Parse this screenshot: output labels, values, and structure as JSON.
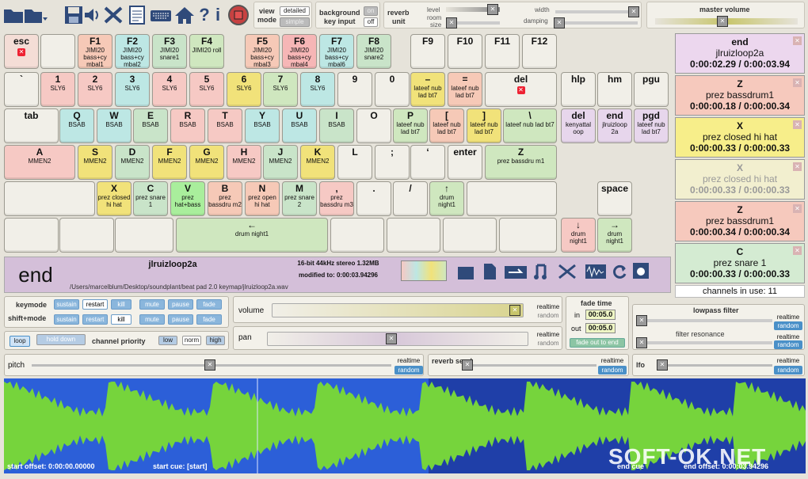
{
  "toolbar": {
    "icons": [
      "folder-icon",
      "folder-dropdown-icon",
      "save-icon",
      "speaker-save-icon",
      "tools-icon",
      "notes-icon",
      "keyboard-icon",
      "home-icon",
      "help-icon",
      "info-icon",
      "record-stop-icon"
    ],
    "view_label": "view",
    "mode_label": "mode",
    "view_detailed": "detailed",
    "view_simple": "simple",
    "background_label": "background",
    "key_input_label": "key input",
    "on_label": "on",
    "off_label": "off",
    "reverb_label": "reverb",
    "unit_label": "unit",
    "level_label": "level",
    "room_label": "room",
    "size_label": "size",
    "width_label": "width",
    "damping_label": "damping",
    "master_volume_label": "master volume"
  },
  "keys": [
    {
      "label": "esc",
      "sub": "",
      "color": "#f4ddd6",
      "close": true
    },
    {
      "label": "F1",
      "sub": "JIMI20 bass+cy mbal1",
      "color": "#f6c9b7"
    },
    {
      "label": "F2",
      "sub": "JIMI20 bass+cy mbal2",
      "color": "#bde7e4"
    },
    {
      "label": "F3",
      "sub": "JIMI20 snare1",
      "color": "#c9e4c9"
    },
    {
      "label": "F4",
      "sub": "JIMI20 roll",
      "color": "#cfe7bf"
    },
    {
      "label": "F5",
      "sub": "JIMI20 bass+cy mbal3",
      "color": "#f6c9b7"
    },
    {
      "label": "F6",
      "sub": "JIMI20 bass+cy mbal4",
      "color": "#f6b6b6"
    },
    {
      "label": "F7",
      "sub": "JIMI20 bass+cy mbal6",
      "color": "#bde7e4"
    },
    {
      "label": "F8",
      "sub": "JIMI20 snare2",
      "color": "#c9e4c9"
    },
    {
      "label": "F9",
      "sub": "",
      "color": "#f1efe8"
    },
    {
      "label": "F10",
      "sub": "",
      "color": "#f1efe8"
    },
    {
      "label": "F11",
      "sub": "",
      "color": "#f1efe8"
    },
    {
      "label": "F12",
      "sub": "",
      "color": "#f1efe8"
    },
    {
      "label": "`",
      "sub": "",
      "color": "#f1efe8"
    },
    {
      "label": "1",
      "sub": "SLY6",
      "color": "#f6c9c4"
    },
    {
      "label": "2",
      "sub": "SLY6",
      "color": "#f6c9c4"
    },
    {
      "label": "3",
      "sub": "SLY6",
      "color": "#bde7e4"
    },
    {
      "label": "4",
      "sub": "SLY6",
      "color": "#f6c9c4"
    },
    {
      "label": "5",
      "sub": "SLY6",
      "color": "#f6c9c4"
    },
    {
      "label": "6",
      "sub": "SLY6",
      "color": "#f1e27a"
    },
    {
      "label": "7",
      "sub": "SLY6",
      "color": "#cfe7bf"
    },
    {
      "label": "8",
      "sub": "SLY6",
      "color": "#bde7e4"
    },
    {
      "label": "9",
      "sub": "",
      "color": "#f1efe8"
    },
    {
      "label": "0",
      "sub": "",
      "color": "#f1efe8"
    },
    {
      "label": "–",
      "sub": "lateef nub lad bt7",
      "color": "#f1e27a"
    },
    {
      "label": "=",
      "sub": "lateef nub lad bt7",
      "color": "#f6c9b7"
    },
    {
      "label": "del",
      "sub": "",
      "color": "#f1efe8",
      "close": true
    },
    {
      "label": "hlp",
      "sub": "",
      "color": "#f1efe8"
    },
    {
      "label": "hm",
      "sub": "",
      "color": "#f1efe8"
    },
    {
      "label": "pgu",
      "sub": "",
      "color": "#f1efe8"
    },
    {
      "label": "tab",
      "sub": "",
      "color": "#f1efe8"
    },
    {
      "label": "Q",
      "sub": "BSAB",
      "color": "#bde7e4"
    },
    {
      "label": "W",
      "sub": "BSAB",
      "color": "#bde7e4"
    },
    {
      "label": "E",
      "sub": "BSAB",
      "color": "#c9e4c9"
    },
    {
      "label": "R",
      "sub": "BSAB",
      "color": "#f6c9c4"
    },
    {
      "label": "T",
      "sub": "BSAB",
      "color": "#f6c9c4"
    },
    {
      "label": "Y",
      "sub": "BSAB",
      "color": "#bde7e4"
    },
    {
      "label": "U",
      "sub": "BSAB",
      "color": "#bde7e4"
    },
    {
      "label": "I",
      "sub": "BSAB",
      "color": "#c9e4c9"
    },
    {
      "label": "O",
      "sub": "",
      "color": "#f1efe8"
    },
    {
      "label": "P",
      "sub": "lateef nub lad bt7",
      "color": "#cfe7bf"
    },
    {
      "label": "[",
      "sub": "lateef nub lad bt7",
      "color": "#f6c9b7"
    },
    {
      "label": "]",
      "sub": "lateef nub lad bt7",
      "color": "#f1e27a"
    },
    {
      "label": "\\",
      "sub": "lateef nub lad bt7",
      "color": "#cfe7bf"
    },
    {
      "label": "del",
      "sub": "kenyattal oop",
      "color": "#e7d6ec"
    },
    {
      "label": "end",
      "sub": "jlruizloop 2a",
      "color": "#e7d6ec"
    },
    {
      "label": "pgd",
      "sub": "lateef nub lad bt7",
      "color": "#e7d6ec"
    },
    {
      "label": "A",
      "sub": "MMEN2",
      "color": "#f6c9c4"
    },
    {
      "label": "S",
      "sub": "MMEN2",
      "color": "#f1e27a"
    },
    {
      "label": "D",
      "sub": "MMEN2",
      "color": "#c9e4c9"
    },
    {
      "label": "F",
      "sub": "MMEN2",
      "color": "#f1e27a"
    },
    {
      "label": "G",
      "sub": "MMEN2",
      "color": "#f1e27a"
    },
    {
      "label": "H",
      "sub": "MMEN2",
      "color": "#f6c9c4"
    },
    {
      "label": "J",
      "sub": "MMEN2",
      "color": "#c9e4c9"
    },
    {
      "label": "K",
      "sub": "MMEN2",
      "color": "#f1e27a"
    },
    {
      "label": "L",
      "sub": "",
      "color": "#f1efe8"
    },
    {
      "label": ";",
      "sub": "",
      "color": "#f1efe8"
    },
    {
      "label": "‘",
      "sub": "",
      "color": "#f1efe8"
    },
    {
      "label": "enter",
      "sub": "",
      "color": "#f1efe8"
    },
    {
      "label": "Z",
      "sub": "prez bassdru m1",
      "color": "#cfe7bf"
    },
    {
      "label": "X",
      "sub": "prez closed hi hat",
      "color": "#f1e27a"
    },
    {
      "label": "C",
      "sub": "prez snare 1",
      "color": "#c9e4c9"
    },
    {
      "label": "V",
      "sub": "prez hat+bass",
      "color": "#a9ee9c"
    },
    {
      "label": "B",
      "sub": "prez bassdru m2",
      "color": "#f6c9b7"
    },
    {
      "label": "N",
      "sub": "prez open hi hat",
      "color": "#f6c9b7"
    },
    {
      "label": "M",
      "sub": "prez snare 2",
      "color": "#c9e4c9"
    },
    {
      "label": ",",
      "sub": "prez bassdru m3",
      "color": "#f6c9c4"
    },
    {
      "label": ".",
      "sub": "",
      "color": "#f1efe8"
    },
    {
      "label": "/",
      "sub": "",
      "color": "#f1efe8"
    },
    {
      "label": "↑",
      "sub": "drum night1",
      "color": "#cfe7bf"
    },
    {
      "label": "space",
      "sub": "",
      "color": "#f1efe8"
    },
    {
      "label": "←",
      "sub": "drum night1",
      "color": "#cfe7bf"
    },
    {
      "label": "↓",
      "sub": "drum night1",
      "color": "#f6c9c4"
    },
    {
      "label": "→",
      "sub": "drum night1",
      "color": "#cfe7bf"
    }
  ],
  "queue": [
    {
      "key": "end",
      "name": "jlruizloop2a",
      "time": "0:00:02.29  /  0:00:03.94",
      "color": "#ecd7ee"
    },
    {
      "key": "Z",
      "name": "prez bassdrum1",
      "time": "0:00:00.18  /  0:00:00.34",
      "color": "#f6c9bd"
    },
    {
      "key": "X",
      "name": "prez closed hi hat",
      "time": "0:00:00.33  /  0:00:00.33",
      "color": "#f7ee8a"
    },
    {
      "key": "X",
      "name": "prez closed hi hat",
      "time": "0:00:00.33  /  0:00:00.33",
      "color": "#f2efcf",
      "faded": true
    },
    {
      "key": "Z",
      "name": "prez bassdrum1",
      "time": "0:00:00.34  /  0:00:00.34",
      "color": "#f6c9bd"
    },
    {
      "key": "C",
      "name": "prez snare 1",
      "time": "0:00:00.33  /  0:00:00.33",
      "color": "#d4ebd2"
    }
  ],
  "channels_in_use": "channels in use: 11",
  "info": {
    "key": "end",
    "name": "jlruizloop2a",
    "format": "16-bit 44kHz stereo 1.32MB",
    "modified": "modified to: 0:00:03.94296",
    "path": "/Users/marcelblum/Desktop/soundplant/beat pad 2.0 keymap/jlruizloop2a.wav"
  },
  "controls": {
    "keymode_label": "keymode",
    "shiftmode_label": "shift+mode",
    "sustain": "sustain",
    "restart": "restart",
    "kill": "kill",
    "mute": "mute",
    "pause": "pause",
    "fade": "fade",
    "loop": "loop",
    "hold_down": "hold down",
    "channel_priority": "channel priority",
    "low": "low",
    "norm": "norm",
    "high": "high",
    "volume": "volume",
    "pan": "pan",
    "pitch": "pitch",
    "realtime": "realtime",
    "random": "random",
    "fade_time": "fade time",
    "in_label": "in",
    "out_label": "out",
    "fade_in": "00:05.0",
    "fade_out": "00:05.0",
    "fade_out_to_end": "fade out to end",
    "lowpass": "lowpass filter",
    "filter_res": "filter resonance",
    "reverb_send": "reverb send",
    "lfo": "lfo"
  },
  "wave": {
    "start_offset": "start offset: 0:00:00.00000",
    "start_cue": "start cue: [start]",
    "end_cue": "end cue",
    "end_offset": "end offset: 0:00:03.94296"
  },
  "watermark": "SOFT-OK.NET"
}
